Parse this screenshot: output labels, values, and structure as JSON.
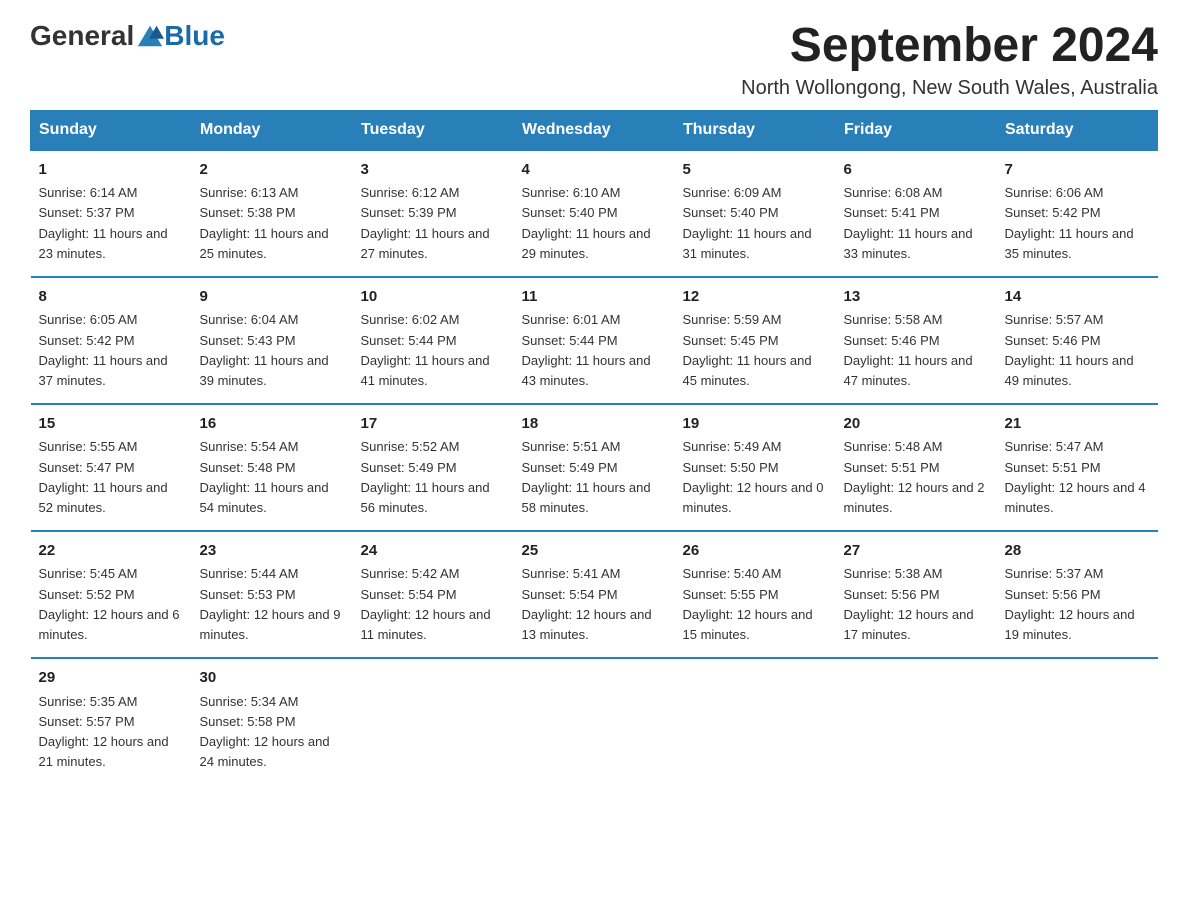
{
  "logo": {
    "general": "General",
    "blue": "Blue"
  },
  "title": "September 2024",
  "subtitle": "North Wollongong, New South Wales, Australia",
  "days_header": [
    "Sunday",
    "Monday",
    "Tuesday",
    "Wednesday",
    "Thursday",
    "Friday",
    "Saturday"
  ],
  "weeks": [
    [
      {
        "day": "1",
        "sunrise": "6:14 AM",
        "sunset": "5:37 PM",
        "daylight": "11 hours and 23 minutes."
      },
      {
        "day": "2",
        "sunrise": "6:13 AM",
        "sunset": "5:38 PM",
        "daylight": "11 hours and 25 minutes."
      },
      {
        "day": "3",
        "sunrise": "6:12 AM",
        "sunset": "5:39 PM",
        "daylight": "11 hours and 27 minutes."
      },
      {
        "day": "4",
        "sunrise": "6:10 AM",
        "sunset": "5:40 PM",
        "daylight": "11 hours and 29 minutes."
      },
      {
        "day": "5",
        "sunrise": "6:09 AM",
        "sunset": "5:40 PM",
        "daylight": "11 hours and 31 minutes."
      },
      {
        "day": "6",
        "sunrise": "6:08 AM",
        "sunset": "5:41 PM",
        "daylight": "11 hours and 33 minutes."
      },
      {
        "day": "7",
        "sunrise": "6:06 AM",
        "sunset": "5:42 PM",
        "daylight": "11 hours and 35 minutes."
      }
    ],
    [
      {
        "day": "8",
        "sunrise": "6:05 AM",
        "sunset": "5:42 PM",
        "daylight": "11 hours and 37 minutes."
      },
      {
        "day": "9",
        "sunrise": "6:04 AM",
        "sunset": "5:43 PM",
        "daylight": "11 hours and 39 minutes."
      },
      {
        "day": "10",
        "sunrise": "6:02 AM",
        "sunset": "5:44 PM",
        "daylight": "11 hours and 41 minutes."
      },
      {
        "day": "11",
        "sunrise": "6:01 AM",
        "sunset": "5:44 PM",
        "daylight": "11 hours and 43 minutes."
      },
      {
        "day": "12",
        "sunrise": "5:59 AM",
        "sunset": "5:45 PM",
        "daylight": "11 hours and 45 minutes."
      },
      {
        "day": "13",
        "sunrise": "5:58 AM",
        "sunset": "5:46 PM",
        "daylight": "11 hours and 47 minutes."
      },
      {
        "day": "14",
        "sunrise": "5:57 AM",
        "sunset": "5:46 PM",
        "daylight": "11 hours and 49 minutes."
      }
    ],
    [
      {
        "day": "15",
        "sunrise": "5:55 AM",
        "sunset": "5:47 PM",
        "daylight": "11 hours and 52 minutes."
      },
      {
        "day": "16",
        "sunrise": "5:54 AM",
        "sunset": "5:48 PM",
        "daylight": "11 hours and 54 minutes."
      },
      {
        "day": "17",
        "sunrise": "5:52 AM",
        "sunset": "5:49 PM",
        "daylight": "11 hours and 56 minutes."
      },
      {
        "day": "18",
        "sunrise": "5:51 AM",
        "sunset": "5:49 PM",
        "daylight": "11 hours and 58 minutes."
      },
      {
        "day": "19",
        "sunrise": "5:49 AM",
        "sunset": "5:50 PM",
        "daylight": "12 hours and 0 minutes."
      },
      {
        "day": "20",
        "sunrise": "5:48 AM",
        "sunset": "5:51 PM",
        "daylight": "12 hours and 2 minutes."
      },
      {
        "day": "21",
        "sunrise": "5:47 AM",
        "sunset": "5:51 PM",
        "daylight": "12 hours and 4 minutes."
      }
    ],
    [
      {
        "day": "22",
        "sunrise": "5:45 AM",
        "sunset": "5:52 PM",
        "daylight": "12 hours and 6 minutes."
      },
      {
        "day": "23",
        "sunrise": "5:44 AM",
        "sunset": "5:53 PM",
        "daylight": "12 hours and 9 minutes."
      },
      {
        "day": "24",
        "sunrise": "5:42 AM",
        "sunset": "5:54 PM",
        "daylight": "12 hours and 11 minutes."
      },
      {
        "day": "25",
        "sunrise": "5:41 AM",
        "sunset": "5:54 PM",
        "daylight": "12 hours and 13 minutes."
      },
      {
        "day": "26",
        "sunrise": "5:40 AM",
        "sunset": "5:55 PM",
        "daylight": "12 hours and 15 minutes."
      },
      {
        "day": "27",
        "sunrise": "5:38 AM",
        "sunset": "5:56 PM",
        "daylight": "12 hours and 17 minutes."
      },
      {
        "day": "28",
        "sunrise": "5:37 AM",
        "sunset": "5:56 PM",
        "daylight": "12 hours and 19 minutes."
      }
    ],
    [
      {
        "day": "29",
        "sunrise": "5:35 AM",
        "sunset": "5:57 PM",
        "daylight": "12 hours and 21 minutes."
      },
      {
        "day": "30",
        "sunrise": "5:34 AM",
        "sunset": "5:58 PM",
        "daylight": "12 hours and 24 minutes."
      },
      null,
      null,
      null,
      null,
      null
    ]
  ],
  "labels": {
    "sunrise": "Sunrise:",
    "sunset": "Sunset:",
    "daylight": "Daylight:"
  }
}
